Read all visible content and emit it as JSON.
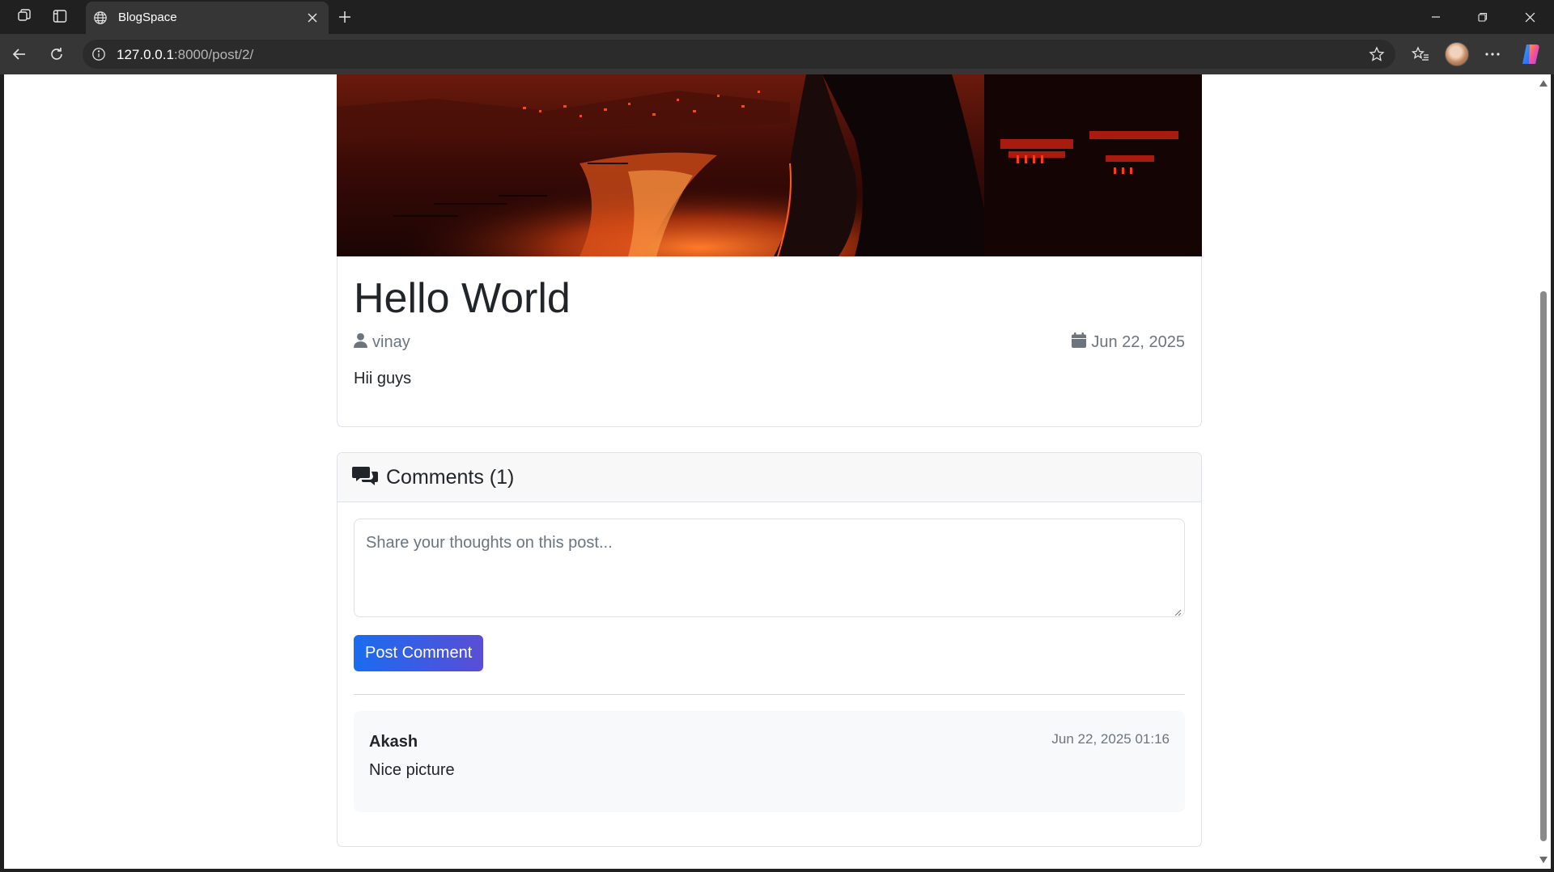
{
  "browser": {
    "tab_title": "BlogSpace",
    "url_host": "127.0.0.1",
    "url_path": ":8000/post/2/",
    "icons": [
      "workspaces-icon",
      "vertical-tabs-icon",
      "globe-icon",
      "close-icon",
      "plus-icon",
      "minimize-icon",
      "restore-icon",
      "close-window-icon",
      "back-icon",
      "refresh-icon",
      "info-icon",
      "star-icon",
      "favorites-icon",
      "avatar",
      "more-icon",
      "copilot-icon"
    ]
  },
  "post": {
    "title": "Hello World",
    "author": "vinay",
    "date": "Jun 22, 2025",
    "body": "Hii guys"
  },
  "comments": {
    "title": "Comments (1)",
    "placeholder": "Share your thoughts on this post...",
    "submit_label": "Post Comment",
    "items": [
      {
        "author": "Akash",
        "timestamp": "Jun 22, 2025 01:16",
        "text": "Nice picture"
      }
    ]
  },
  "colors": {
    "accent_start": "#1a6cf0",
    "accent_end": "#5a4dd6",
    "text": "#212529",
    "muted": "#6c757d",
    "border": "#dee2e6"
  }
}
